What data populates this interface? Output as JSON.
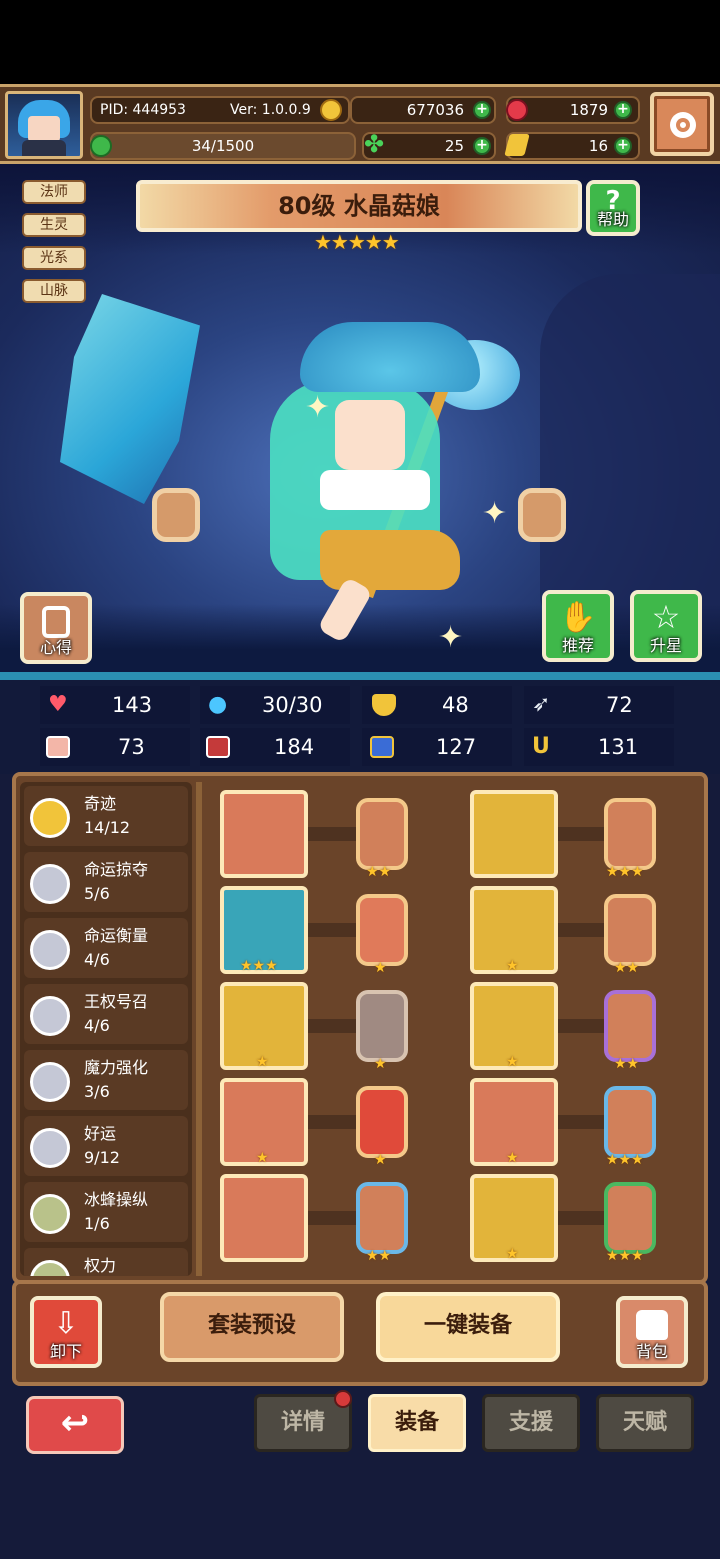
{
  "topbar": {
    "pid": "PID: 444953",
    "version": "Ver: 1.0.0.9",
    "gold": "677036",
    "gems": "1879",
    "energy": "34/1500",
    "clover": "25",
    "tickets": "16"
  },
  "hero": {
    "tags": [
      "法师",
      "生灵",
      "光系",
      "山脉"
    ],
    "name": "80级  水晶菇娘",
    "stars": "★★★★★",
    "help_label": "帮助",
    "insight_label": "心得",
    "recommend_label": "推荐",
    "star_up_label": "升星"
  },
  "stats": {
    "hp": "143",
    "mana": "30/30",
    "defense": "48",
    "speed": "72",
    "attack": "73",
    "magic": "184",
    "magic_defense": "127",
    "luck": "131"
  },
  "sets": [
    {
      "name": "奇迹",
      "count": "14/12"
    },
    {
      "name": "命运掠夺",
      "count": "5/6"
    },
    {
      "name": "命运衡量",
      "count": "4/6"
    },
    {
      "name": "王权号召",
      "count": "4/6"
    },
    {
      "name": "魔力强化",
      "count": "3/6"
    },
    {
      "name": "好运",
      "count": "9/12"
    },
    {
      "name": "冰蜂操纵",
      "count": "1/6"
    },
    {
      "name": "权力",
      "count": ""
    }
  ],
  "equipment": {
    "left": [
      {
        "item": "scepter",
        "item_stars": "",
        "gem_stars": "★★"
      },
      {
        "item": "crystal-orb",
        "item_stars": "★★★",
        "gem_stars": "★"
      },
      {
        "item": "necklace",
        "item_stars": "★",
        "gem_stars": "★"
      },
      {
        "item": "brooch",
        "item_stars": "★",
        "gem_stars": "★"
      },
      {
        "item": "ring",
        "item_stars": "",
        "gem_stars": "★★"
      }
    ],
    "right": [
      {
        "item": "crown",
        "item_stars": "",
        "gem_stars": "★★★"
      },
      {
        "item": "robe",
        "item_stars": "★",
        "gem_stars": "★★"
      },
      {
        "item": "bracer",
        "item_stars": "★",
        "gem_stars": "★★"
      },
      {
        "item": "helmet",
        "item_stars": "★",
        "gem_stars": "★★★"
      },
      {
        "item": "boots",
        "item_stars": "★",
        "gem_stars": "★★★"
      }
    ]
  },
  "actions": {
    "unequip": "卸下",
    "preset": "套装预设",
    "auto_equip": "一键装备",
    "bag": "背包"
  },
  "tabs": {
    "details": "详情",
    "equipment": "装备",
    "support": "支援",
    "talent": "天赋"
  },
  "colors": {
    "accent_gold": "#ffc42b",
    "panel_brown": "#6a4429",
    "green_button": "#3fb84a"
  }
}
